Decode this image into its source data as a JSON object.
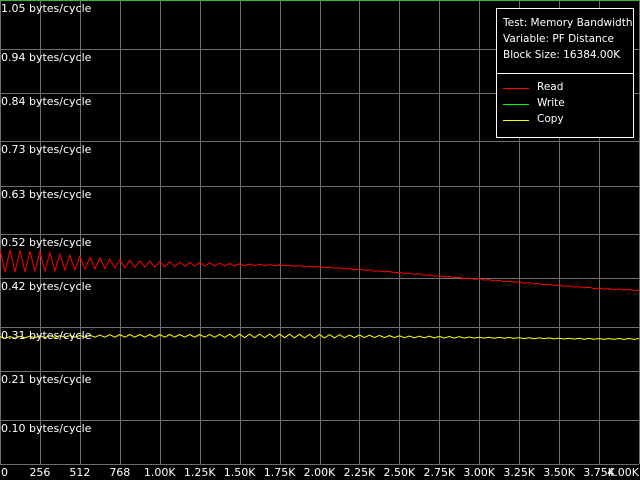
{
  "chart_data": {
    "type": "line",
    "title": "",
    "xlabel": "",
    "ylabel": "",
    "xlim": [
      0,
      4096
    ],
    "ylim": [
      0.0,
      1.05
    ],
    "grid": true,
    "legend_placement": "top-right",
    "x_tick_values": [
      0,
      256,
      512,
      768,
      1024,
      1280,
      1536,
      1792,
      2048,
      2304,
      2560,
      2816,
      3072,
      3328,
      3584,
      3840,
      4096
    ],
    "x_tick_labels": [
      "0",
      "256",
      "512",
      "768",
      "1.00K",
      "1.25K",
      "1.50K",
      "1.75K",
      "2.00K",
      "2.25K",
      "2.50K",
      "2.75K",
      "3.00K",
      "3.25K",
      "3.50K",
      "3.75K",
      "4.00K"
    ],
    "y_tick_values": [
      0.1,
      0.21,
      0.31,
      0.42,
      0.52,
      0.63,
      0.73,
      0.84,
      0.94,
      1.05
    ],
    "y_tick_labels": [
      "0.10 bytes/cycle",
      "0.21 bytes/cycle",
      "0.31 bytes/cycle",
      "0.42 bytes/cycle",
      "0.52 bytes/cycle",
      "0.63 bytes/cycle",
      "0.73 bytes/cycle",
      "0.84 bytes/cycle",
      "0.94 bytes/cycle",
      "1.05 bytes/cycle"
    ],
    "info": [
      "Test: Memory Bandwidth",
      "Variable: PF Distance",
      "Block Size: 16384.00K"
    ],
    "series": [
      {
        "name": "Read",
        "color": "#ff0000",
        "x": [
          0,
          256,
          512,
          768,
          1024,
          1280,
          1536,
          1792,
          2048,
          2304,
          2560,
          2816,
          3072,
          3328,
          3584,
          3840,
          4096
        ],
        "values": [
          0.46,
          0.458,
          0.455,
          0.453,
          0.452,
          0.452,
          0.451,
          0.45,
          0.446,
          0.44,
          0.433,
          0.425,
          0.418,
          0.411,
          0.404,
          0.397,
          0.393
        ],
        "osc_amplitude": [
          0.026,
          0.022,
          0.015,
          0.009,
          0.006,
          0.004,
          0.002,
          0.001,
          0.001,
          0.001,
          0.001,
          0.001,
          0.001,
          0.001,
          0.001,
          0.001,
          0.001
        ]
      },
      {
        "name": "Write",
        "color": "#00ff00",
        "x": [
          0,
          4096
        ],
        "values": [
          1.05,
          1.05
        ],
        "osc_amplitude": [
          0,
          0
        ]
      },
      {
        "name": "Copy",
        "color": "#ffff00",
        "x": [
          0,
          256,
          512,
          768,
          1024,
          1280,
          1536,
          1792,
          2048,
          2304,
          2560,
          2816,
          3072,
          3328,
          3584,
          3840,
          4096
        ],
        "values": [
          0.286,
          0.288,
          0.289,
          0.29,
          0.29,
          0.29,
          0.29,
          0.29,
          0.289,
          0.289,
          0.288,
          0.287,
          0.286,
          0.285,
          0.284,
          0.283,
          0.283
        ],
        "osc_amplitude": [
          0.002,
          0.002,
          0.002,
          0.003,
          0.003,
          0.003,
          0.004,
          0.004,
          0.004,
          0.003,
          0.002,
          0.002,
          0.001,
          0.001,
          0.001,
          0.001,
          0.001
        ]
      }
    ]
  }
}
